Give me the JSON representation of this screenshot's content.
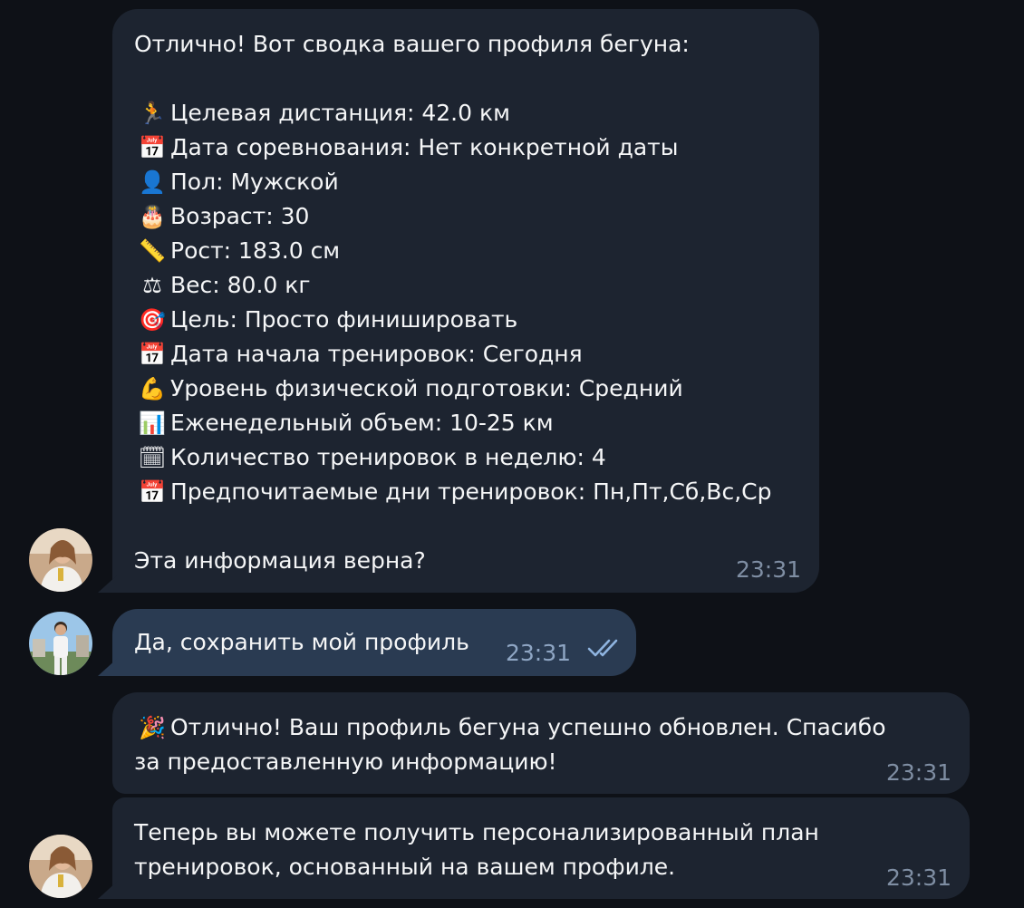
{
  "messages": {
    "profile_summary": {
      "intro": "Отлично! Вот сводка вашего профиля бегуна:",
      "items": [
        {
          "icon": "runner-emoji",
          "glyph": "🏃",
          "text": "Целевая дистанция: 42.0 км"
        },
        {
          "icon": "calendar-emoji",
          "glyph": "📅",
          "text": "Дата соревнования: Нет конкретной даты"
        },
        {
          "icon": "person-emoji",
          "glyph": "👤",
          "text": "Пол: Мужской"
        },
        {
          "icon": "cake-emoji",
          "glyph": "🎂",
          "text": "Возраст: 30"
        },
        {
          "icon": "ruler-emoji",
          "glyph": "📏",
          "text": "Рост: 183.0 см"
        },
        {
          "icon": "scales-emoji",
          "glyph": "⚖",
          "text": "Вес: 80.0 кг"
        },
        {
          "icon": "target-emoji",
          "glyph": "🎯",
          "text": "Цель: Просто финишировать"
        },
        {
          "icon": "calendar-emoji",
          "glyph": "📅",
          "text": "Дата начала тренировок: Сегодня"
        },
        {
          "icon": "muscle-emoji",
          "glyph": "💪",
          "text": "Уровень физической подготовки: Средний"
        },
        {
          "icon": "bar-chart-emoji",
          "glyph": "📊",
          "text": "Еженедельный объем: 10-25 км"
        },
        {
          "icon": "spiral-calendar-emoji",
          "glyph": "🗓",
          "text": "Количество тренировок в неделю: 4"
        },
        {
          "icon": "calendar-emoji",
          "glyph": "📅",
          "text": "Предпочитаемые дни тренировок: Пн,Пт,Сб,Вс,Ср"
        }
      ],
      "question": "Эта информация верна?",
      "time": "23:31"
    },
    "user_reply": {
      "text": "Да, сохранить мой профиль",
      "time": "23:31",
      "status_icon": "double-check-icon"
    },
    "confirmation": {
      "icon": "party-popper-emoji",
      "glyph": "🎉",
      "line1": "Отлично! Ваш профиль бегуна успешно обновлен. Спасибо",
      "line2": "за предоставленную информацию!",
      "time": "23:31"
    },
    "followup": {
      "line1": "Теперь вы можете получить персонализированный план",
      "line2": "тренировок, основанный на вашем профиле.",
      "time": "23:31"
    }
  },
  "colors": {
    "background": "#0e1117",
    "incoming_bubble": "#1d2430",
    "outgoing_bubble": "#2a3b52",
    "text": "#f5f6f7",
    "time_incoming": "#7f8ea3",
    "check": "#8fb4e0"
  }
}
